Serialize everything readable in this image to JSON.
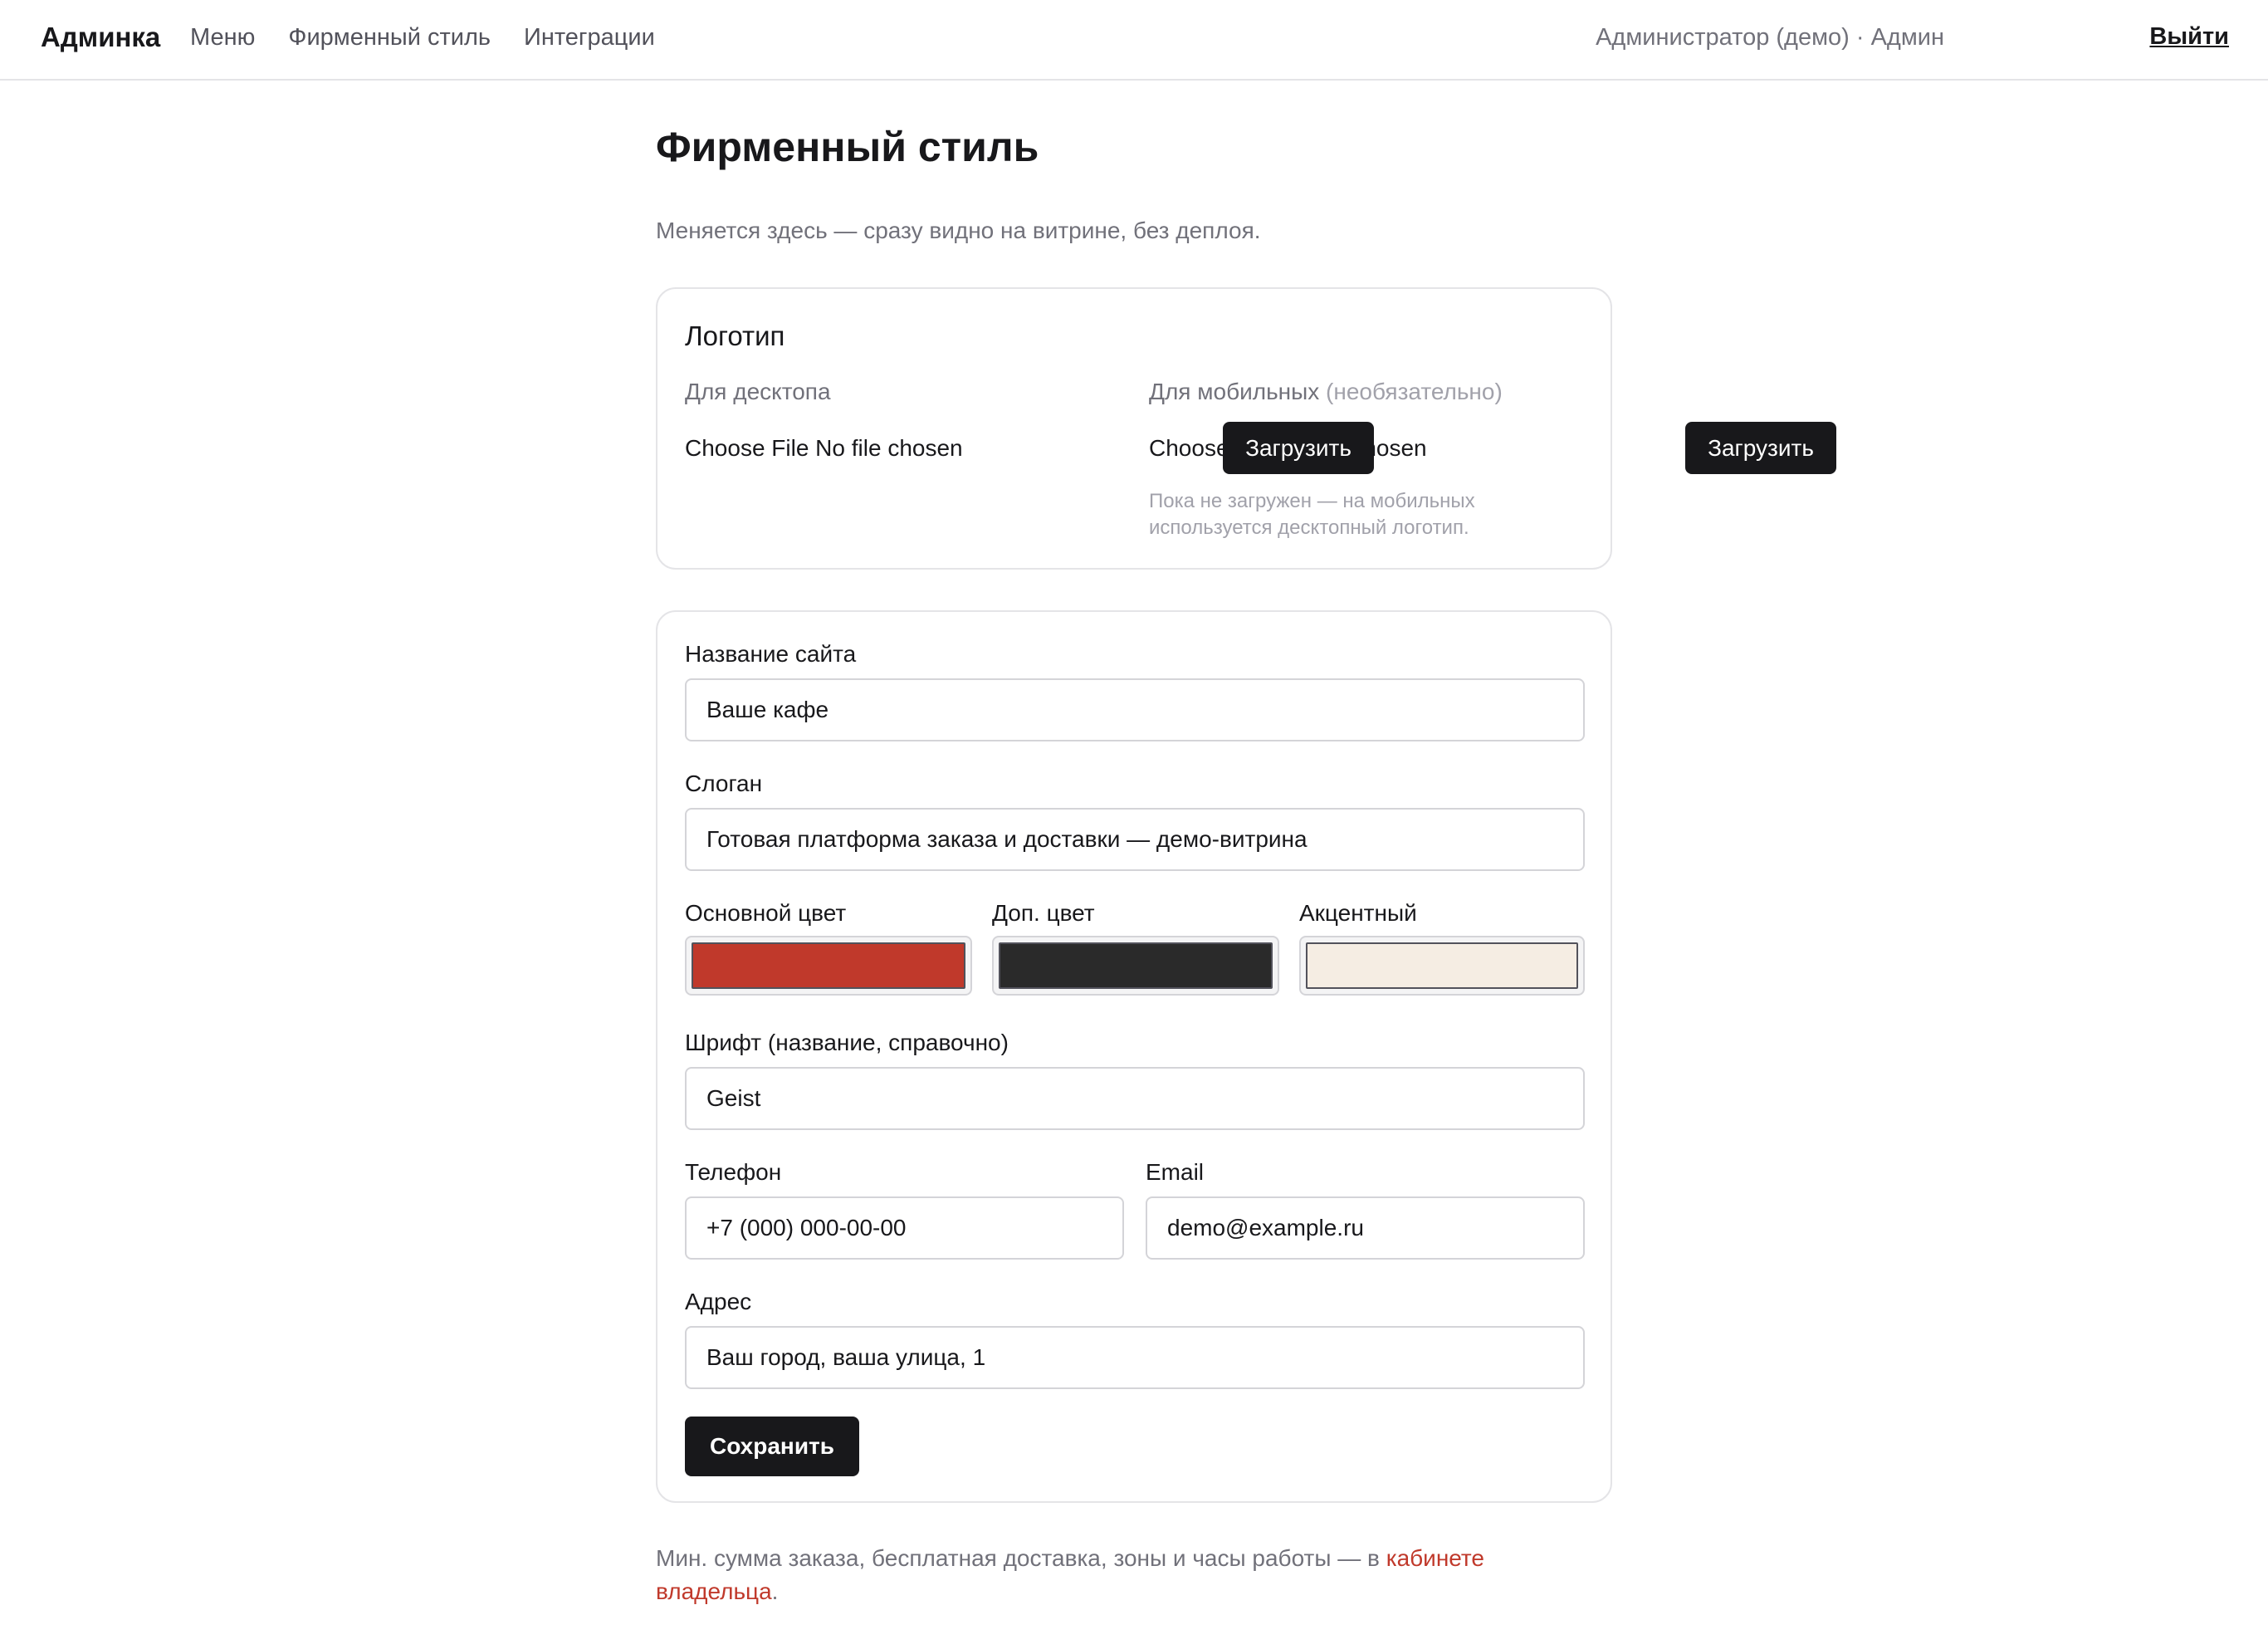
{
  "topbar": {
    "brand": "Админка",
    "nav": [
      "Меню",
      "Фирменный стиль",
      "Интеграции"
    ],
    "user": "Администратор (демо) · Админ",
    "logout": "Выйти"
  },
  "page": {
    "title": "Фирменный стиль",
    "subtitle": "Меняется здесь — сразу видно на витрине, без деплоя."
  },
  "logo_card": {
    "title": "Логотип",
    "desktop_label": "Для десктопа",
    "mobile_label": "Для мобильных",
    "mobile_optional": "(необязательно)",
    "desktop_file_text": "Choose File No file chosen",
    "mobile_file_text": "Choose File No file chosen",
    "upload_label": "Загрузить",
    "mobile_hint": "Пока не загружен — на мобильных используется десктопный логотип."
  },
  "form": {
    "site_name_label": "Название сайта",
    "site_name_value": "Ваше кафе",
    "slogan_label": "Слоган",
    "slogan_value": "Готовая платформа заказа и доставки — демо-витрина",
    "primary_color_label": "Основной цвет",
    "secondary_color_label": "Доп. цвет",
    "accent_color_label": "Акцентный",
    "font_label": "Шрифт (название, справочно)",
    "font_value": "Geist",
    "phone_label": "Телефон",
    "phone_value": "+7 (000) 000-00-00",
    "email_label": "Email",
    "email_value": "demo@example.ru",
    "address_label": "Адрес",
    "address_value": "Ваш город, ваша улица, 1",
    "save_label": "Сохранить"
  },
  "colors": {
    "primary": "#c0392b",
    "secondary": "#2a2a2a",
    "accent": "#f5ede3"
  },
  "footer": {
    "text": "Мин. сумма заказа, бесплатная доставка, зоны и часы работы — в ",
    "link": "кабинете владельца",
    "end": "."
  }
}
